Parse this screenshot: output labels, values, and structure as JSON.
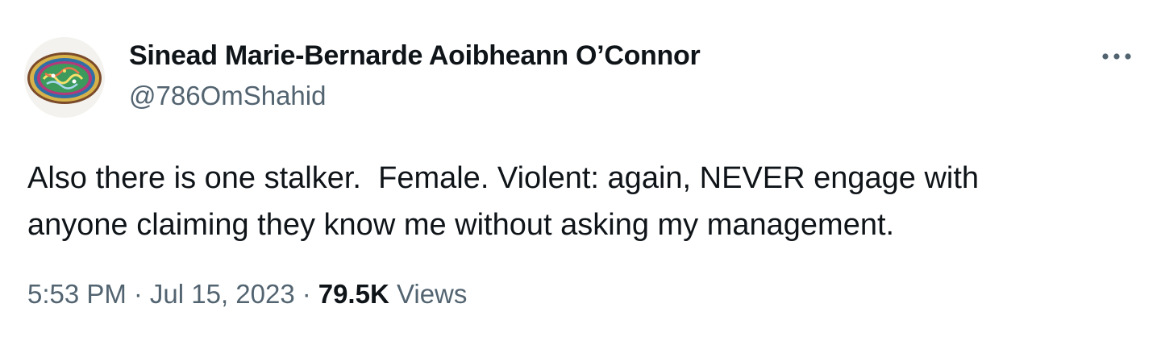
{
  "user": {
    "display_name": "Sinead Marie-Bernarde Aoibheann O’Connor",
    "handle": "@786OmShahid",
    "avatar_icon": "calligraphy-emblem-avatar"
  },
  "more_icon": "ellipsis-icon",
  "tweet": {
    "text": "Also there is one stalker.  Female. Violent: again, NEVER engage with\nanyone claiming they know me without asking my management."
  },
  "meta": {
    "time": "5:53 PM",
    "separator": "·",
    "date": "Jul 15, 2023",
    "views_count": "79.5K",
    "views_label": "Views"
  },
  "colors": {
    "primary_text": "#0f1419",
    "secondary_text": "#536471",
    "background": "#ffffff"
  }
}
